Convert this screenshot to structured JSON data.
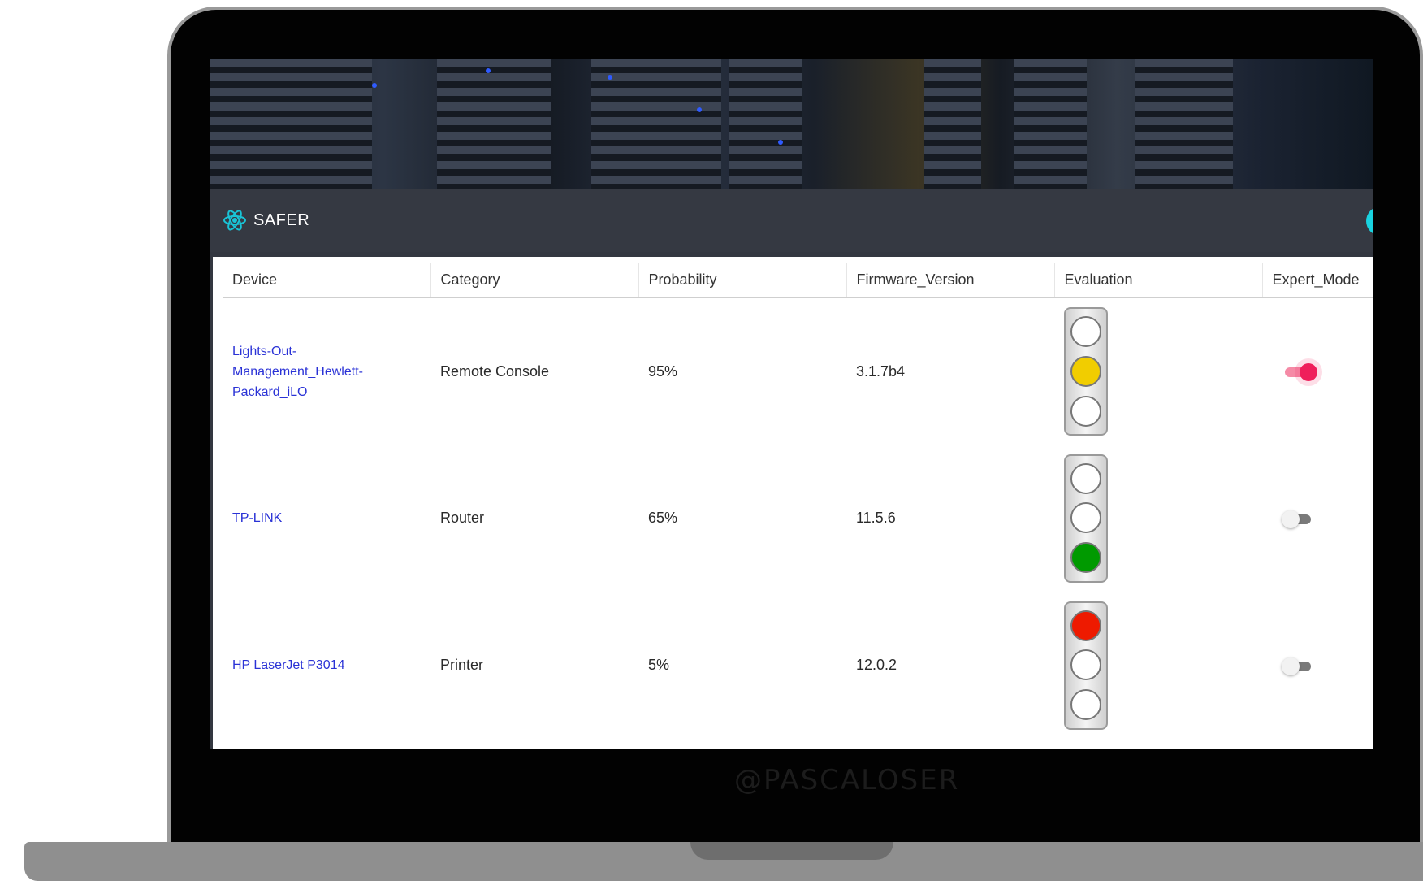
{
  "app": {
    "title": "SAFER",
    "watermark": "@PASCALOSER"
  },
  "colors": {
    "accent": "#19d3e0",
    "link": "#2a32d6",
    "toggle_on": "#ef1f5b",
    "lamp_off": "#ffffff",
    "lamp_yellow": "#f1cd00",
    "lamp_green": "#009a00",
    "lamp_red": "#ee1a00"
  },
  "table": {
    "headers": [
      "Device",
      "Category",
      "Probability",
      "Firmware_Version",
      "Evaluation",
      "Expert_Mode"
    ],
    "rows": [
      {
        "device": "Lights-Out-Management_Hewlett-Packard_iLO",
        "category": "Remote Console",
        "probability": "95%",
        "firmware": "3.1.7b4",
        "evaluation": [
          "off",
          "yellow",
          "off"
        ],
        "expert_mode": true
      },
      {
        "device": "TP-LINK",
        "category": "Router",
        "probability": "65%",
        "firmware": "11.5.6",
        "evaluation": [
          "off",
          "off",
          "green"
        ],
        "expert_mode": false
      },
      {
        "device": "HP LaserJet P3014",
        "category": "Printer",
        "probability": "5%",
        "firmware": "12.0.2",
        "evaluation": [
          "red",
          "off",
          "off"
        ],
        "expert_mode": false
      }
    ]
  }
}
